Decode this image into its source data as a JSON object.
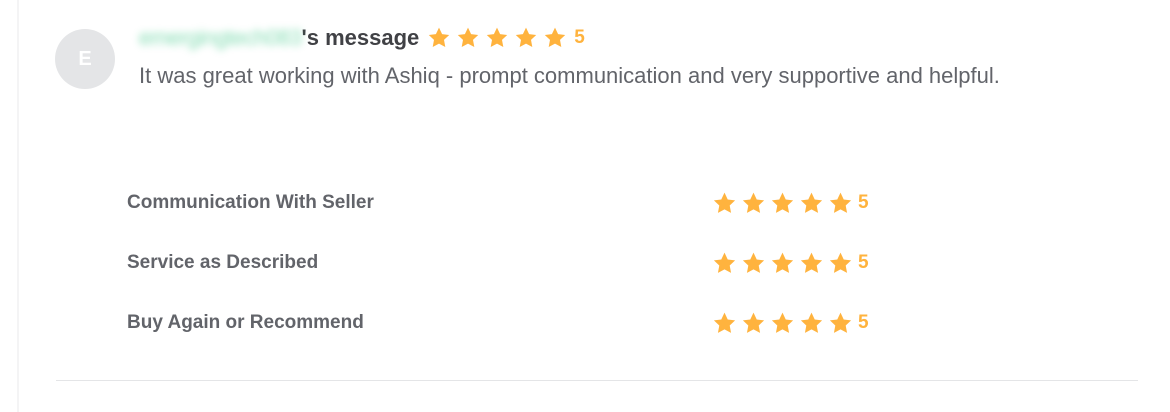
{
  "review": {
    "avatar_initial": "E",
    "username": "emergingtech083",
    "header_suffix": "'s message",
    "overall_rating": "5",
    "overall_stars": 5,
    "message": "It was great working with Ashiq - prompt communication and very supportive and helpful."
  },
  "criteria": [
    {
      "label": "Communication With Seller",
      "rating": "5",
      "stars": 5
    },
    {
      "label": "Service as Described",
      "rating": "5",
      "stars": 5
    },
    {
      "label": "Buy Again or Recommend",
      "rating": "5",
      "stars": 5
    }
  ],
  "colors": {
    "star": "#ffb33e",
    "avatar_bg": "#e4e5e7",
    "text": "#62646a",
    "heading": "#404145"
  },
  "icons": {
    "star": "star-icon"
  }
}
